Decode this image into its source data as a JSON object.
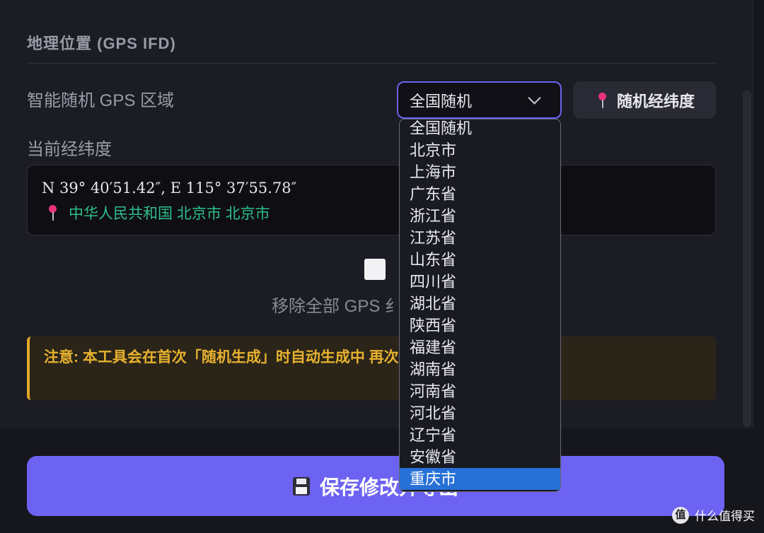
{
  "section": {
    "title": "地理位置 (GPS IFD)"
  },
  "region": {
    "label": "智能随机 GPS 区域",
    "selected_value": "全国随机",
    "random_button_label": "随机经纬度",
    "options": [
      "全国随机",
      "北京市",
      "上海市",
      "广东省",
      "浙江省",
      "江苏省",
      "山东省",
      "四川省",
      "湖北省",
      "陕西省",
      "福建省",
      "湖南省",
      "河南省",
      "河北省",
      "辽宁省",
      "安徽省",
      "重庆市"
    ],
    "highlighted_option": "重庆市"
  },
  "current": {
    "label": "当前经纬度",
    "coordinates": "N 39° 40′51.42″, E 115° 37′55.78″",
    "location": "中华人民共和国 北京市 北京市"
  },
  "remove": {
    "checked": false,
    "label": "移除全部 GPS 纟"
  },
  "warning": {
    "text": "注意: 本工具会在首次「随机生成」时自动生成中                         再次随机需点击上方按钮。"
  },
  "save": {
    "label": "保存修改并导出"
  },
  "watermark": {
    "text": "什么值得买",
    "logo": "值"
  },
  "colors": {
    "accent": "#6c63f2",
    "warning": "#e8b22f",
    "location": "#2fbf8a",
    "highlight": "#2670d6"
  }
}
